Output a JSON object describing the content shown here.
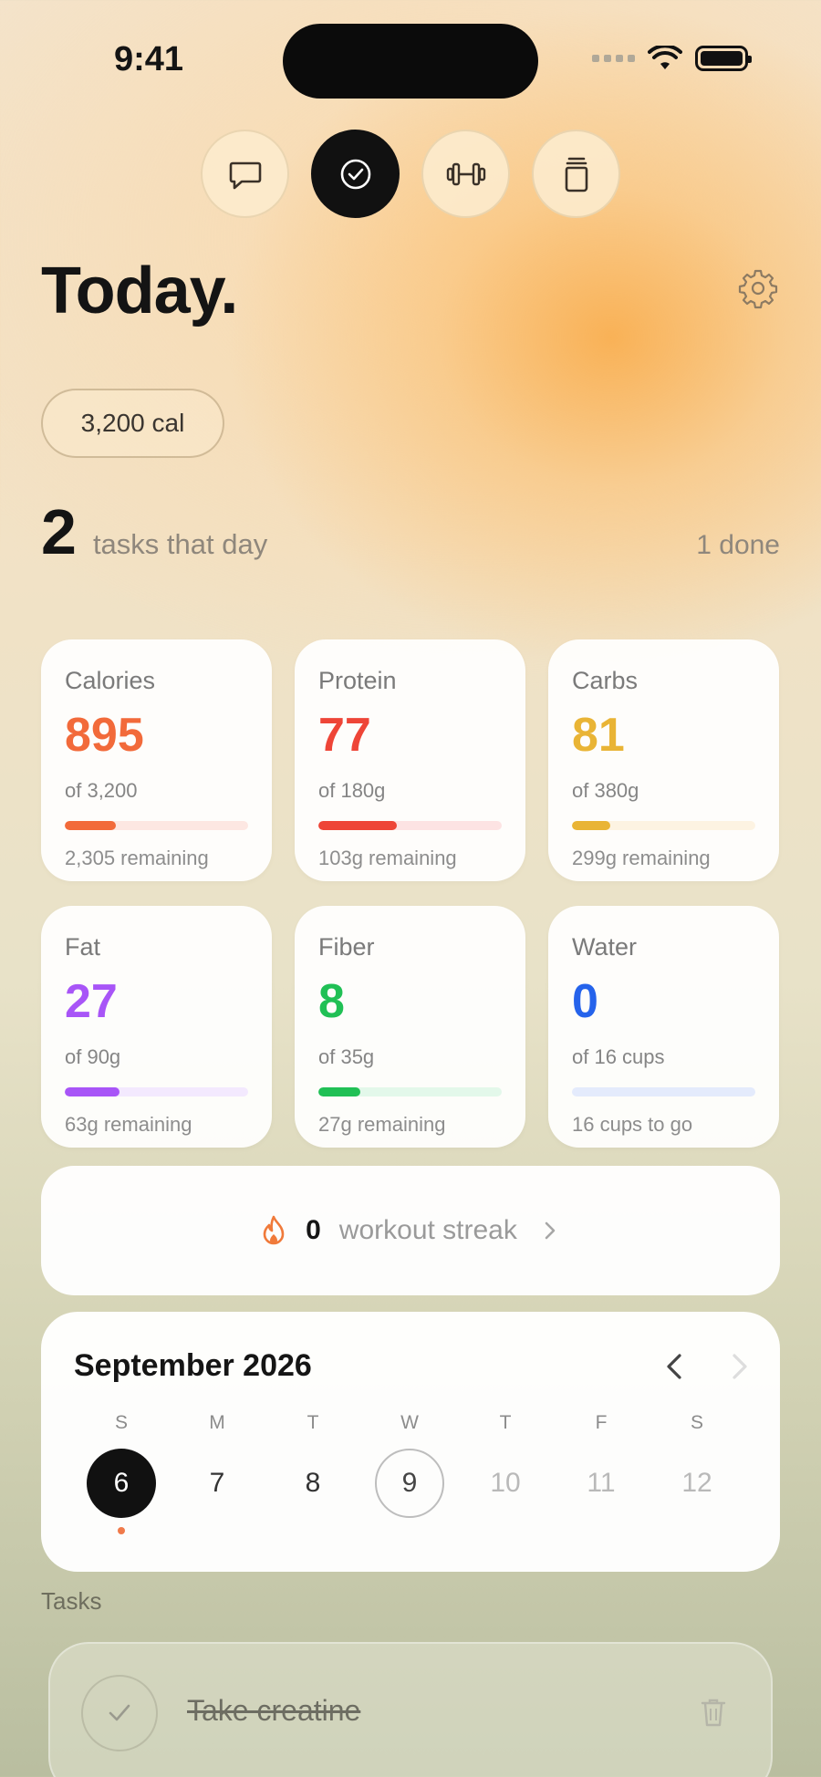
{
  "status_bar": {
    "time": "9:41"
  },
  "top_nav": [
    {
      "icon": "chat-bubble-icon",
      "active": false
    },
    {
      "icon": "check-circle-icon",
      "active": true
    },
    {
      "icon": "dumbbell-icon",
      "active": false
    },
    {
      "icon": "supplement-jar-icon",
      "active": false
    }
  ],
  "header": {
    "title": "Today."
  },
  "calorie_target": "3,200 cal",
  "task_summary": {
    "count": "2",
    "label": "tasks that day",
    "done": "1 done"
  },
  "macros": [
    {
      "label": "Calories",
      "value": "895",
      "of": "of 3,200",
      "remaining": "2,305 remaining",
      "progress": 0.28,
      "color": "#f26a3a",
      "track": "#fde7e2"
    },
    {
      "label": "Protein",
      "value": "77",
      "of": "of 180g",
      "remaining": "103g remaining",
      "progress": 0.43,
      "color": "#ee4537",
      "track": "#fde3e3"
    },
    {
      "label": "Carbs",
      "value": "81",
      "of": "of 380g",
      "remaining": "299g remaining",
      "progress": 0.21,
      "color": "#e9b435",
      "track": "#fdf3e2"
    },
    {
      "label": "Fat",
      "value": "27",
      "of": "of 90g",
      "remaining": "63g remaining",
      "progress": 0.3,
      "color": "#a855f7",
      "track": "#f3e9fe"
    },
    {
      "label": "Fiber",
      "value": "8",
      "of": "of 35g",
      "remaining": "27g remaining",
      "progress": 0.23,
      "color": "#20c055",
      "track": "#e3f8ea"
    },
    {
      "label": "Water",
      "value": "0",
      "of": "of 16 cups",
      "remaining": "16 cups to go",
      "progress": 0.0,
      "color": "#2563eb",
      "track": "#e4ebfc"
    }
  ],
  "streak": {
    "count": "0",
    "label": "workout streak"
  },
  "calendar": {
    "month": "September 2026",
    "weekdays": [
      "S",
      "M",
      "T",
      "W",
      "T",
      "F",
      "S"
    ],
    "days": [
      {
        "num": "6",
        "state": "selected",
        "dot": true
      },
      {
        "num": "7",
        "state": "past",
        "dot": false
      },
      {
        "num": "8",
        "state": "past",
        "dot": false
      },
      {
        "num": "9",
        "state": "today",
        "dot": false
      },
      {
        "num": "10",
        "state": "future",
        "dot": false
      },
      {
        "num": "11",
        "state": "future",
        "dot": false
      },
      {
        "num": "12",
        "state": "future",
        "dot": false
      }
    ]
  },
  "tasks": {
    "section_label": "Tasks",
    "items": [
      {
        "title": "Take creatine",
        "done": true
      }
    ]
  }
}
